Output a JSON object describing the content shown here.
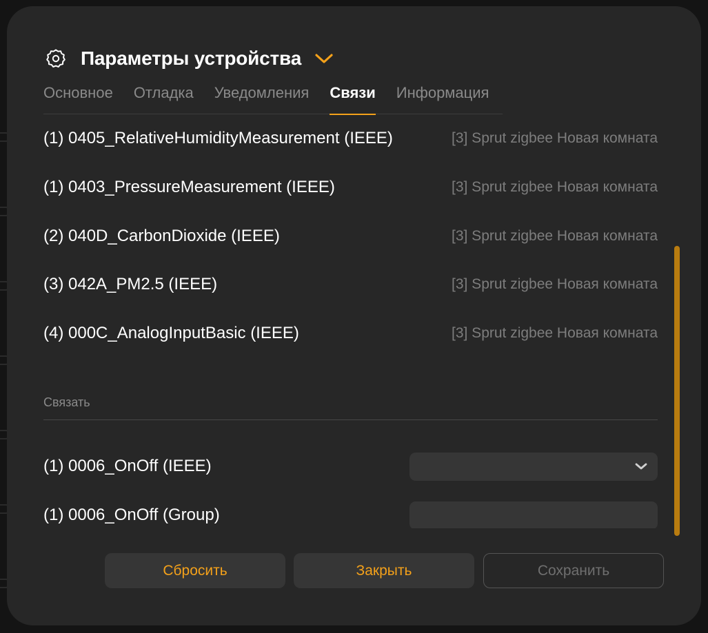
{
  "header": {
    "title": "Параметры устройства",
    "icon": "gear-icon",
    "chevron_icon": "chevron-down-icon"
  },
  "tabs": [
    {
      "label": "Основное",
      "active": false
    },
    {
      "label": "Отладка",
      "active": false
    },
    {
      "label": "Уведомления",
      "active": false
    },
    {
      "label": "Связи",
      "active": true
    },
    {
      "label": "Информация",
      "active": false
    }
  ],
  "links": [
    {
      "name": "(1) 0405_RelativeHumidityMeasurement (IEEE)",
      "target": "[3] Sprut zigbee Новая комната"
    },
    {
      "name": "(1) 0403_PressureMeasurement (IEEE)",
      "target": "[3] Sprut zigbee Новая комната"
    },
    {
      "name": "(2) 040D_CarbonDioxide (IEEE)",
      "target": "[3] Sprut zigbee Новая комната"
    },
    {
      "name": "(3) 042A_PM2.5 (IEEE)",
      "target": "[3] Sprut zigbee Новая комната"
    },
    {
      "name": "(4) 000C_AnalogInputBasic (IEEE)",
      "target": "[3] Sprut zigbee Новая комната"
    }
  ],
  "bind_section": {
    "label": "Связать",
    "rows": [
      {
        "name": "(1) 0006_OnOff (IEEE)",
        "control": "select",
        "value": ""
      },
      {
        "name": "(1) 0006_OnOff (Group)",
        "control": "input",
        "value": ""
      }
    ]
  },
  "buttons": {
    "reset": "Сбросить",
    "close": "Закрыть",
    "save": "Сохранить"
  },
  "colors": {
    "accent": "#f4a11a",
    "modal_bg": "#272727",
    "scrollbar": "#b97c10"
  }
}
